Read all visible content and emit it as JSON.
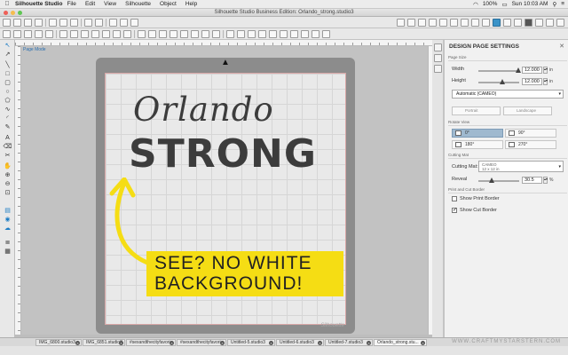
{
  "menubar": {
    "apple": "",
    "app_name": "Silhouette Studio",
    "items": [
      "File",
      "Edit",
      "View",
      "Silhouette",
      "Object",
      "Help"
    ],
    "battery": "100%",
    "clock": "Sun 10:03 AM"
  },
  "window": {
    "title": "Silhouette Studio Business Edition: Orlando_strong.studio3"
  },
  "canvas": {
    "page_label": "Page Mode",
    "brand": "Silhouette"
  },
  "design": {
    "word1": "Orlando",
    "word2": "STRONG",
    "callout_line1": "SEE? NO WHITE",
    "callout_line2": "BACKGROUND!",
    "callout_color": "#f5dd14"
  },
  "panel": {
    "title": "DESIGN PAGE SETTINGS",
    "page_size_header": "Page Size",
    "width_label": "Width",
    "width_value": "12.000",
    "height_label": "Height",
    "height_value": "12.000",
    "unit": "in",
    "media": "Automatic (CAMEO)",
    "portrait": "Portrait",
    "landscape": "Landscape",
    "rotate_header": "Rotate View",
    "rot_0": "0°",
    "rot_90": "90°",
    "rot_180": "180°",
    "rot_270": "270°",
    "cutting_mat_header": "Cutting Mat",
    "cutting_mat_label": "Cutting Mat:",
    "cutting_mat_value": "CAMEO",
    "cutting_mat_size": "12 x 12 in",
    "reveal_label": "Reveal",
    "reveal_value": "30.5",
    "reveal_unit": "%",
    "border_header": "Print and Cut Border",
    "show_print_border": "Show Print Border",
    "show_cut_border": "Show Cut Border"
  },
  "tabs": [
    {
      "label": "IMG_6800.studio3"
    },
    {
      "label": "IMG_6851.studio3"
    },
    {
      "label": "#sexandthecityfavori..."
    },
    {
      "label": "#sexandthecityfavori..."
    },
    {
      "label": "Untitled-5.studio3"
    },
    {
      "label": "Untitled-6.studio3"
    },
    {
      "label": "Untitled-7.studio3"
    },
    {
      "label": "Orlando_strong.stu..."
    }
  ],
  "watermark": "WWW.CRAFTMYSTARSTERN.COM"
}
